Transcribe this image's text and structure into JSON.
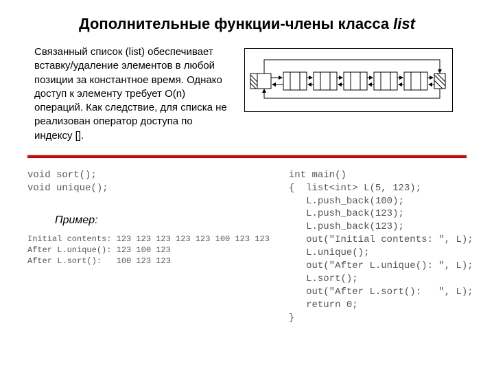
{
  "title_main": "Дополнительные функции-члены класса ",
  "title_italic": "list",
  "intro": "Связанный список (list) обеспечивает вставку/удаление элементов в любой позиции за константное время. Однако доступ к элементу требует O(n) операций. Как следствие, для списка не реализован оператор доступа по индексу [].",
  "code_left": "void sort();\nvoid unique();",
  "example_label": "Пример:",
  "output": "Initial contents: 123 123 123 123 123 100 123 123\nAfter L.unique(): 123 100 123\nAfter L.sort():   100 123 123",
  "code_right": "int main()\n{  list<int> L(5, 123);\n   L.push_back(100);\n   L.push_back(123);\n   L.push_back(123);\n   out(\"Initial contents: \", L);\n   L.unique();\n   out(\"After L.unique(): \", L);\n   L.sort();\n   out(\"After L.sort():   \", L);\n   return 0;\n}"
}
